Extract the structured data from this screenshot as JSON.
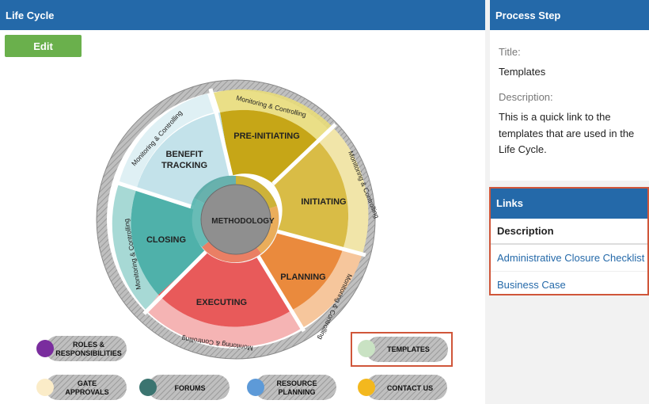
{
  "lifecycle": {
    "title": "Life Cycle",
    "edit_label": "Edit",
    "center_label": "METHODOLOGY",
    "segments": {
      "pre_initiating": "PRE-INITIATING",
      "initiating": "INITIATING",
      "planning": "PLANNING",
      "executing": "EXECUTING",
      "closing": "CLOSING",
      "benefit_tracking_1": "BENEFIT",
      "benefit_tracking_2": "TRACKING"
    },
    "ring_label": "Monitoring & Controlling",
    "legend": {
      "roles_1": "ROLES &",
      "roles_2": "RESPONSIBILITIES",
      "templates": "TEMPLATES",
      "gate_1": "GATE",
      "gate_2": "APPROVALS",
      "forums": "FORUMS",
      "resource_1": "RESOURCE",
      "resource_2": "PLANNING",
      "contact": "CONTACT US"
    },
    "colors": {
      "pre_initiating": "#c6a617",
      "initiating": "#d9bc46",
      "planning": "#ea8a3d",
      "executing": "#e85a5a",
      "closing": "#4fb1aa",
      "benefit_tracking": "#c3e2ea",
      "roles": "#7a2d9e",
      "templates": "#c9e2c3",
      "gate": "#fbecc8",
      "forums": "#3b7470",
      "resource": "#5d9ad8",
      "contact": "#f3b81e"
    }
  },
  "process_step": {
    "header": "Process Step",
    "title_label": "Title:",
    "title_value": "Templates",
    "description_label": "Description:",
    "description_line1": "This is a quick link to the",
    "description_line2": "templates that are used in the",
    "description_line3": "Life Cycle."
  },
  "links": {
    "header": "Links",
    "column": "Description",
    "items": [
      "Administrative Closure Checklist",
      "Business Case"
    ]
  }
}
